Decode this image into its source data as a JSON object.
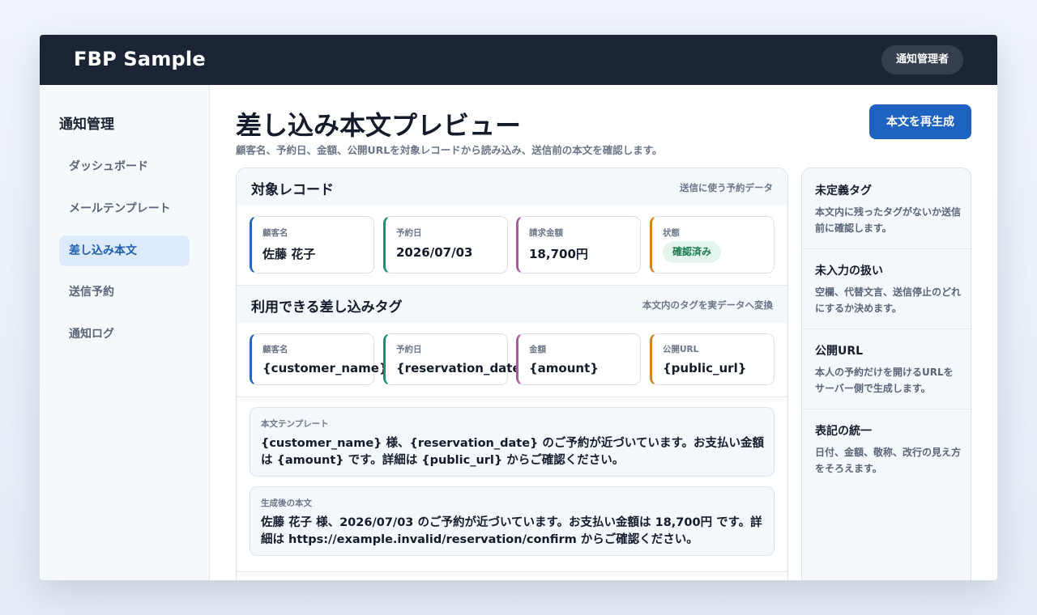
{
  "header": {
    "brand": "FBP Sample",
    "user_role": "通知管理者"
  },
  "sidebar": {
    "title": "通知管理",
    "items": [
      {
        "label": "ダッシュボード",
        "active": false
      },
      {
        "label": "メールテンプレート",
        "active": false
      },
      {
        "label": "差し込み本文",
        "active": true
      },
      {
        "label": "送信予約",
        "active": false
      },
      {
        "label": "通知ログ",
        "active": false
      }
    ]
  },
  "main": {
    "title": "差し込み本文プレビュー",
    "subtitle": "顧客名、予約日、金額、公開URLを対象レコードから読み込み、送信前の本文を確認します。",
    "regenerate_label": "本文を再生成"
  },
  "target_record": {
    "title": "対象レコード",
    "note": "送信に使う予約データ",
    "fields": [
      {
        "label": "顧客名",
        "value": "佐藤 花子"
      },
      {
        "label": "予約日",
        "value": "2026/07/03"
      },
      {
        "label": "請求金額",
        "value": "18,700円"
      },
      {
        "label": "状態",
        "value": "確認済み"
      }
    ]
  },
  "tags": {
    "title": "利用できる差し込みタグ",
    "note": "本文内のタグを実データへ変換",
    "items": [
      {
        "label": "顧客名",
        "value": "{customer_name}"
      },
      {
        "label": "予約日",
        "value": "{reservation_date}"
      },
      {
        "label": "金額",
        "value": "{amount}"
      },
      {
        "label": "公開URL",
        "value": "{public_url}"
      }
    ]
  },
  "template": {
    "label": "本文テンプレート",
    "text": "{customer_name} 様、{reservation_date} のご予約が近づいています。お支払い金額は {amount} です。詳細は {public_url} からご確認ください。"
  },
  "generated": {
    "label": "生成後の本文",
    "text": "佐藤 花子 様、2026/07/03 のご予約が近づいています。お支払い金額は 18,700円 です。詳細は https://example.invalid/reservation/confirm からご確認ください。"
  },
  "tips": [
    {
      "title": "未定義タグ",
      "body": "本文内に残ったタグがないか送信前に確認します。"
    },
    {
      "title": "未入力の扱い",
      "body": "空欄、代替文言、送信停止のどれにするか決めます。"
    },
    {
      "title": "公開URL",
      "body": "本人の予約だけを開けるURLをサーバー側で生成します。"
    },
    {
      "title": "表記の統一",
      "body": "日付、金額、敬称、改行の見え方をそろえます。"
    }
  ],
  "colors": {
    "topbar": "#1c2535",
    "accent": "#1e63c1",
    "active_nav_bg": "#dceafb",
    "status_badge_bg": "#e3f5ec",
    "status_badge_text": "#1a7a4f",
    "tile_accents": [
      "#2366c0",
      "#1a9170",
      "#a85c9d",
      "#d1841e"
    ]
  }
}
